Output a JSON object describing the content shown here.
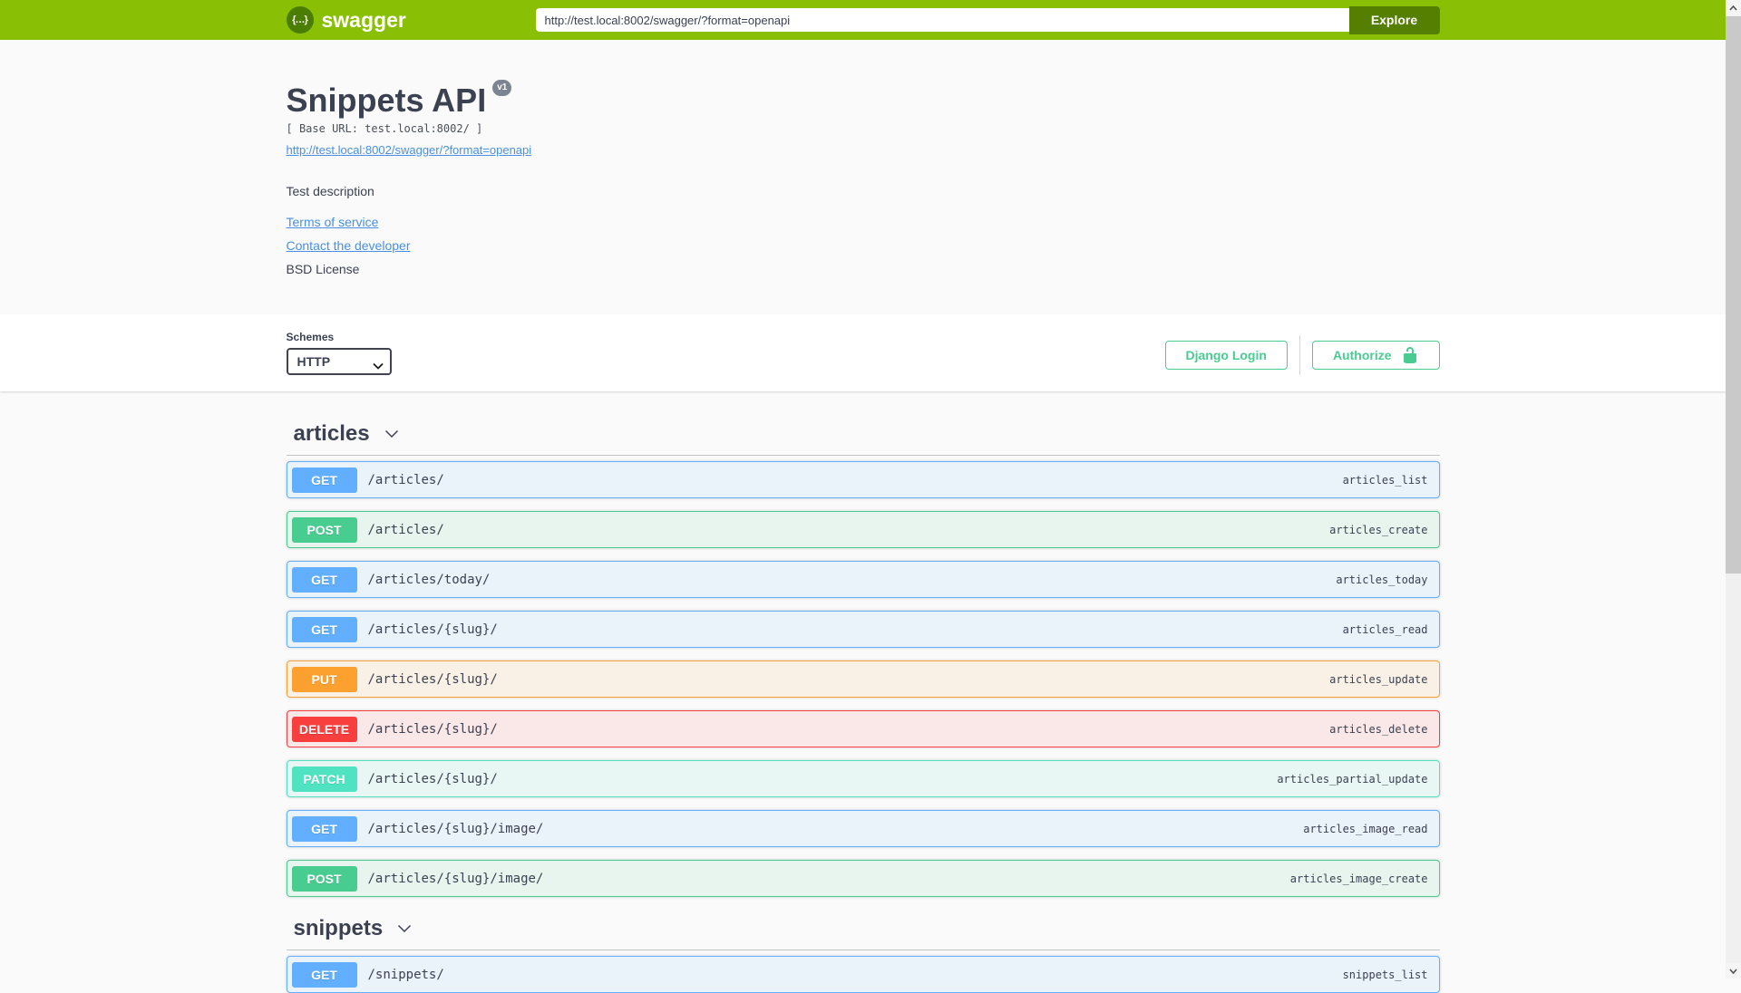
{
  "topbar": {
    "brand": "swagger",
    "logo_glyph": "{…}",
    "url_value": "http://test.local:8002/swagger/?format=openapi",
    "explore_label": "Explore"
  },
  "info": {
    "title": "Snippets API",
    "version_badge": "v1",
    "base_url": "[ Base URL: test.local:8002/ ]",
    "spec_link": "http://test.local:8002/swagger/?format=openapi",
    "description": "Test description",
    "terms_link": "Terms of service",
    "contact_link": "Contact the developer",
    "license_text": "BSD License"
  },
  "scheme": {
    "label": "Schemes",
    "selected": "HTTP",
    "django_login_label": "Django Login",
    "authorize_label": "Authorize"
  },
  "method_colors": {
    "GET": {
      "badge": "#61affe",
      "border": "#61affe",
      "background": "#eaf2fa"
    },
    "POST": {
      "badge": "#49cc90",
      "border": "#49cc90",
      "background": "#e8f5ef"
    },
    "PUT": {
      "badge": "#fca130",
      "border": "#fca130",
      "background": "#faf1e6"
    },
    "DELETE": {
      "badge": "#f93e3e",
      "border": "#f93e3e",
      "background": "#fae7e7"
    },
    "PATCH": {
      "badge": "#50e3c2",
      "border": "#50e3c2",
      "background": "#e9f7f4"
    }
  },
  "brand_colors": {
    "topbar": "#89bf04",
    "explore_button": "#547f00",
    "auth_green": "#49cc90",
    "link_blue": "#4990e2",
    "text": "#3b4151"
  },
  "sections": [
    {
      "tag": "articles",
      "operations": [
        {
          "method": "GET",
          "path": "/articles/",
          "operation_id": "articles_list"
        },
        {
          "method": "POST",
          "path": "/articles/",
          "operation_id": "articles_create"
        },
        {
          "method": "GET",
          "path": "/articles/today/",
          "operation_id": "articles_today"
        },
        {
          "method": "GET",
          "path": "/articles/{slug}/",
          "operation_id": "articles_read"
        },
        {
          "method": "PUT",
          "path": "/articles/{slug}/",
          "operation_id": "articles_update"
        },
        {
          "method": "DELETE",
          "path": "/articles/{slug}/",
          "operation_id": "articles_delete"
        },
        {
          "method": "PATCH",
          "path": "/articles/{slug}/",
          "operation_id": "articles_partial_update"
        },
        {
          "method": "GET",
          "path": "/articles/{slug}/image/",
          "operation_id": "articles_image_read"
        },
        {
          "method": "POST",
          "path": "/articles/{slug}/image/",
          "operation_id": "articles_image_create"
        }
      ]
    },
    {
      "tag": "snippets",
      "operations": [
        {
          "method": "GET",
          "path": "/snippets/",
          "operation_id": "snippets_list"
        }
      ]
    }
  ]
}
